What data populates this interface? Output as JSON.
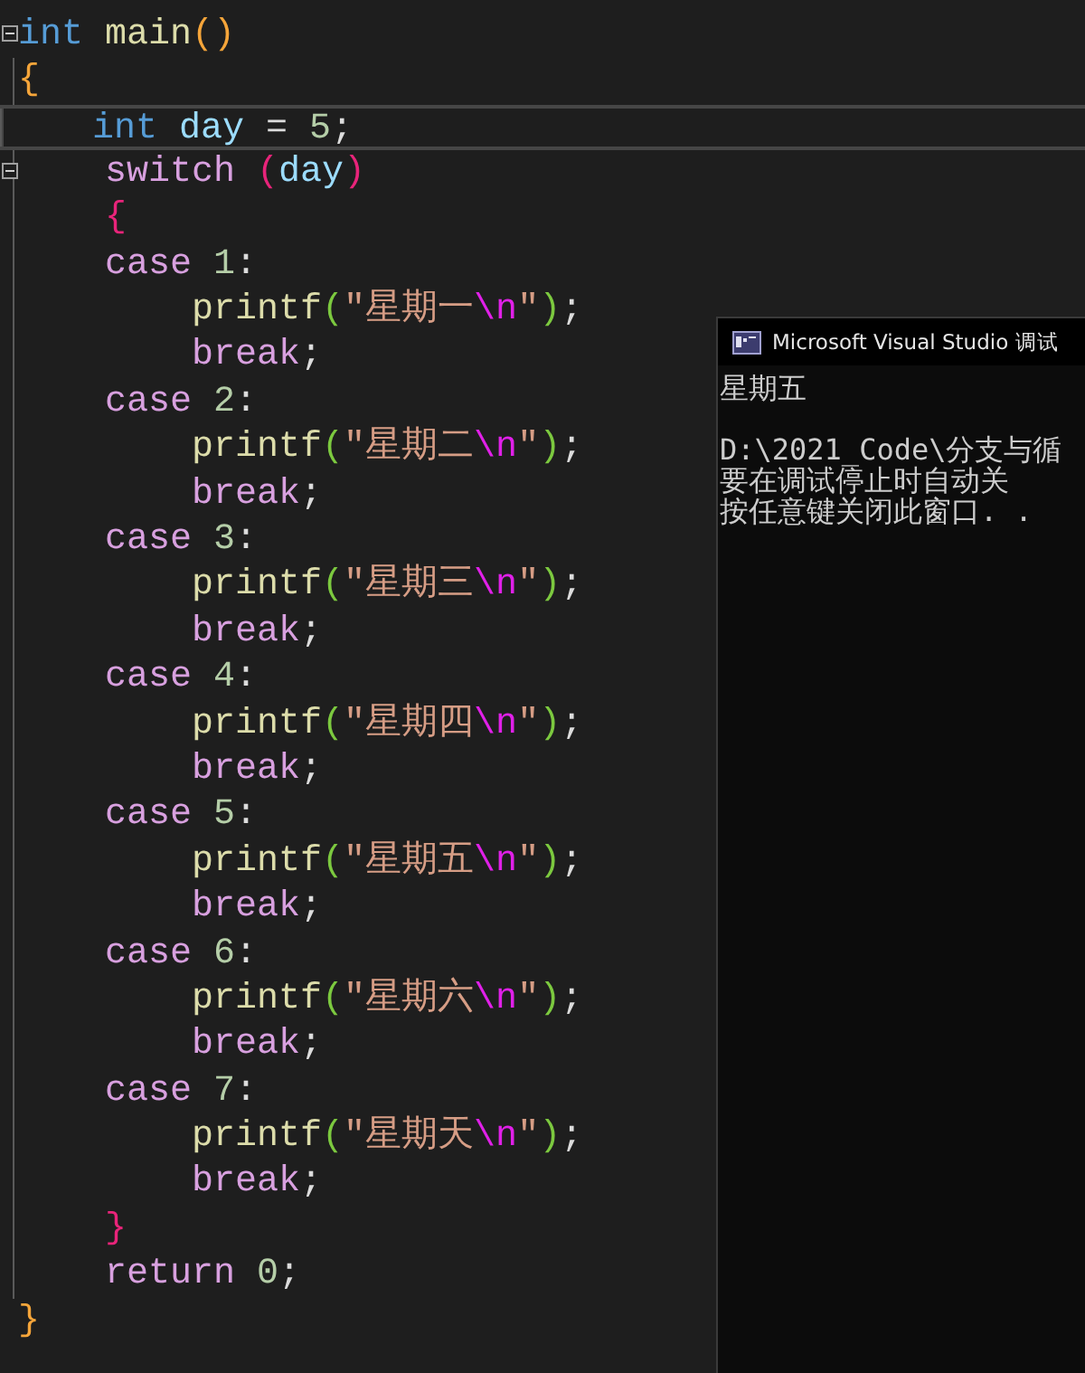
{
  "editor": {
    "lines": [
      {
        "foldable": true,
        "current": false,
        "tokens": [
          {
            "kind": "keyword",
            "space_before": false,
            "text": "int"
          },
          {
            "kind": "function",
            "space_before": true,
            "text": "main"
          },
          {
            "kind": "paren",
            "space_before": false,
            "text": "()"
          }
        ]
      },
      {
        "foldable": false,
        "current": false,
        "tokens": [
          {
            "kind": "brace",
            "space_before": false,
            "text": "{"
          }
        ],
        "children": [
          {
            "foldable": false,
            "current": true,
            "tokens": [
              {
                "kind": "keyword",
                "space_before": false,
                "text": "int"
              },
              {
                "kind": "variable",
                "space_before": true,
                "text": "day"
              },
              {
                "kind": "operator",
                "space_before": true,
                "text": "="
              },
              {
                "kind": "number",
                "space_before": true,
                "text": "5"
              },
              {
                "kind": "punct",
                "space_before": false,
                "text": ";"
              }
            ]
          },
          {
            "foldable": true,
            "current": false,
            "tokens": [
              {
                "kind": "control",
                "space_before": false,
                "text": "switch"
              },
              {
                "kind": "paren2",
                "space_before": true,
                "text": "("
              },
              {
                "kind": "variable",
                "space_before": false,
                "text": "day"
              },
              {
                "kind": "paren2",
                "space_before": false,
                "text": ")"
              }
            ]
          },
          {
            "foldable": false,
            "current": false,
            "tokens": [
              {
                "kind": "brace2",
                "space_before": false,
                "text": "{"
              }
            ]
          },
          {
            "foldable": false,
            "current": false,
            "tokens": [
              {
                "kind": "control",
                "space_before": false,
                "text": "case"
              },
              {
                "kind": "number",
                "space_before": true,
                "text": "1"
              },
              {
                "kind": "punct",
                "space_before": false,
                "text": ":"
              }
            ],
            "children": [
              {
                "foldable": false,
                "current": false,
                "tokens": [
                  {
                    "kind": "function",
                    "space_before": false,
                    "text": "printf"
                  },
                  {
                    "kind": "paren3",
                    "space_before": false,
                    "text": "("
                  },
                  {
                    "kind": "string",
                    "space_before": false,
                    "text": "\"星期一"
                  },
                  {
                    "kind": "escape",
                    "space_before": false,
                    "text": "\\n"
                  },
                  {
                    "kind": "string",
                    "space_before": false,
                    "text": "\""
                  },
                  {
                    "kind": "paren3",
                    "space_before": false,
                    "text": ")"
                  },
                  {
                    "kind": "punct",
                    "space_before": false,
                    "text": ";"
                  }
                ]
              },
              {
                "foldable": false,
                "current": false,
                "tokens": [
                  {
                    "kind": "control",
                    "space_before": false,
                    "text": "break"
                  },
                  {
                    "kind": "punct",
                    "space_before": false,
                    "text": ";"
                  }
                ]
              }
            ]
          },
          {
            "foldable": false,
            "current": false,
            "tokens": [
              {
                "kind": "control",
                "space_before": false,
                "text": "case"
              },
              {
                "kind": "number",
                "space_before": true,
                "text": "2"
              },
              {
                "kind": "punct",
                "space_before": false,
                "text": ":"
              }
            ],
            "children": [
              {
                "foldable": false,
                "current": false,
                "tokens": [
                  {
                    "kind": "function",
                    "space_before": false,
                    "text": "printf"
                  },
                  {
                    "kind": "paren3",
                    "space_before": false,
                    "text": "("
                  },
                  {
                    "kind": "string",
                    "space_before": false,
                    "text": "\"星期二"
                  },
                  {
                    "kind": "escape",
                    "space_before": false,
                    "text": "\\n"
                  },
                  {
                    "kind": "string",
                    "space_before": false,
                    "text": "\""
                  },
                  {
                    "kind": "paren3",
                    "space_before": false,
                    "text": ")"
                  },
                  {
                    "kind": "punct",
                    "space_before": false,
                    "text": ";"
                  }
                ]
              },
              {
                "foldable": false,
                "current": false,
                "tokens": [
                  {
                    "kind": "control",
                    "space_before": false,
                    "text": "break"
                  },
                  {
                    "kind": "punct",
                    "space_before": false,
                    "text": ";"
                  }
                ]
              }
            ]
          },
          {
            "foldable": false,
            "current": false,
            "tokens": [
              {
                "kind": "control",
                "space_before": false,
                "text": "case"
              },
              {
                "kind": "number",
                "space_before": true,
                "text": "3"
              },
              {
                "kind": "punct",
                "space_before": false,
                "text": ":"
              }
            ],
            "children": [
              {
                "foldable": false,
                "current": false,
                "tokens": [
                  {
                    "kind": "function",
                    "space_before": false,
                    "text": "printf"
                  },
                  {
                    "kind": "paren3",
                    "space_before": false,
                    "text": "("
                  },
                  {
                    "kind": "string",
                    "space_before": false,
                    "text": "\"星期三"
                  },
                  {
                    "kind": "escape",
                    "space_before": false,
                    "text": "\\n"
                  },
                  {
                    "kind": "string",
                    "space_before": false,
                    "text": "\""
                  },
                  {
                    "kind": "paren3",
                    "space_before": false,
                    "text": ")"
                  },
                  {
                    "kind": "punct",
                    "space_before": false,
                    "text": ";"
                  }
                ]
              },
              {
                "foldable": false,
                "current": false,
                "tokens": [
                  {
                    "kind": "control",
                    "space_before": false,
                    "text": "break"
                  },
                  {
                    "kind": "punct",
                    "space_before": false,
                    "text": ";"
                  }
                ]
              }
            ]
          },
          {
            "foldable": false,
            "current": false,
            "tokens": [
              {
                "kind": "control",
                "space_before": false,
                "text": "case"
              },
              {
                "kind": "number",
                "space_before": true,
                "text": "4"
              },
              {
                "kind": "punct",
                "space_before": false,
                "text": ":"
              }
            ],
            "children": [
              {
                "foldable": false,
                "current": false,
                "tokens": [
                  {
                    "kind": "function",
                    "space_before": false,
                    "text": "printf"
                  },
                  {
                    "kind": "paren3",
                    "space_before": false,
                    "text": "("
                  },
                  {
                    "kind": "string",
                    "space_before": false,
                    "text": "\"星期四"
                  },
                  {
                    "kind": "escape",
                    "space_before": false,
                    "text": "\\n"
                  },
                  {
                    "kind": "string",
                    "space_before": false,
                    "text": "\""
                  },
                  {
                    "kind": "paren3",
                    "space_before": false,
                    "text": ")"
                  },
                  {
                    "kind": "punct",
                    "space_before": false,
                    "text": ";"
                  }
                ]
              },
              {
                "foldable": false,
                "current": false,
                "tokens": [
                  {
                    "kind": "control",
                    "space_before": false,
                    "text": "break"
                  },
                  {
                    "kind": "punct",
                    "space_before": false,
                    "text": ";"
                  }
                ]
              }
            ]
          },
          {
            "foldable": false,
            "current": false,
            "tokens": [
              {
                "kind": "control",
                "space_before": false,
                "text": "case"
              },
              {
                "kind": "number",
                "space_before": true,
                "text": "5"
              },
              {
                "kind": "punct",
                "space_before": false,
                "text": ":"
              }
            ],
            "children": [
              {
                "foldable": false,
                "current": false,
                "tokens": [
                  {
                    "kind": "function",
                    "space_before": false,
                    "text": "printf"
                  },
                  {
                    "kind": "paren3",
                    "space_before": false,
                    "text": "("
                  },
                  {
                    "kind": "string",
                    "space_before": false,
                    "text": "\"星期五"
                  },
                  {
                    "kind": "escape",
                    "space_before": false,
                    "text": "\\n"
                  },
                  {
                    "kind": "string",
                    "space_before": false,
                    "text": "\""
                  },
                  {
                    "kind": "paren3",
                    "space_before": false,
                    "text": ")"
                  },
                  {
                    "kind": "punct",
                    "space_before": false,
                    "text": ";"
                  }
                ]
              },
              {
                "foldable": false,
                "current": false,
                "tokens": [
                  {
                    "kind": "control",
                    "space_before": false,
                    "text": "break"
                  },
                  {
                    "kind": "punct",
                    "space_before": false,
                    "text": ";"
                  }
                ]
              }
            ]
          },
          {
            "foldable": false,
            "current": false,
            "tokens": [
              {
                "kind": "control",
                "space_before": false,
                "text": "case"
              },
              {
                "kind": "number",
                "space_before": true,
                "text": "6"
              },
              {
                "kind": "punct",
                "space_before": false,
                "text": ":"
              }
            ],
            "children": [
              {
                "foldable": false,
                "current": false,
                "tokens": [
                  {
                    "kind": "function",
                    "space_before": false,
                    "text": "printf"
                  },
                  {
                    "kind": "paren3",
                    "space_before": false,
                    "text": "("
                  },
                  {
                    "kind": "string",
                    "space_before": false,
                    "text": "\"星期六"
                  },
                  {
                    "kind": "escape",
                    "space_before": false,
                    "text": "\\n"
                  },
                  {
                    "kind": "string",
                    "space_before": false,
                    "text": "\""
                  },
                  {
                    "kind": "paren3",
                    "space_before": false,
                    "text": ")"
                  },
                  {
                    "kind": "punct",
                    "space_before": false,
                    "text": ";"
                  }
                ]
              },
              {
                "foldable": false,
                "current": false,
                "tokens": [
                  {
                    "kind": "control",
                    "space_before": false,
                    "text": "break"
                  },
                  {
                    "kind": "punct",
                    "space_before": false,
                    "text": ";"
                  }
                ]
              }
            ]
          },
          {
            "foldable": false,
            "current": false,
            "tokens": [
              {
                "kind": "control",
                "space_before": false,
                "text": "case"
              },
              {
                "kind": "number",
                "space_before": true,
                "text": "7"
              },
              {
                "kind": "punct",
                "space_before": false,
                "text": ":"
              }
            ],
            "children": [
              {
                "foldable": false,
                "current": false,
                "tokens": [
                  {
                    "kind": "function",
                    "space_before": false,
                    "text": "printf"
                  },
                  {
                    "kind": "paren3",
                    "space_before": false,
                    "text": "("
                  },
                  {
                    "kind": "string",
                    "space_before": false,
                    "text": "\"星期天"
                  },
                  {
                    "kind": "escape",
                    "space_before": false,
                    "text": "\\n"
                  },
                  {
                    "kind": "string",
                    "space_before": false,
                    "text": "\""
                  },
                  {
                    "kind": "paren3",
                    "space_before": false,
                    "text": ")"
                  },
                  {
                    "kind": "punct",
                    "space_before": false,
                    "text": ";"
                  }
                ]
              },
              {
                "foldable": false,
                "current": false,
                "tokens": [
                  {
                    "kind": "control",
                    "space_before": false,
                    "text": "break"
                  },
                  {
                    "kind": "punct",
                    "space_before": false,
                    "text": ";"
                  }
                ]
              }
            ]
          },
          {
            "foldable": false,
            "current": false,
            "tokens": [
              {
                "kind": "brace2",
                "space_before": false,
                "text": "}"
              }
            ]
          },
          {
            "foldable": false,
            "current": false,
            "tokens": [
              {
                "kind": "control",
                "space_before": false,
                "text": "return"
              },
              {
                "kind": "number",
                "space_before": true,
                "text": "0"
              },
              {
                "kind": "punct",
                "space_before": false,
                "text": ";"
              }
            ]
          }
        ]
      },
      {
        "foldable": false,
        "current": false,
        "tokens": [
          {
            "kind": "brace",
            "space_before": false,
            "text": "}"
          }
        ]
      }
    ]
  },
  "console": {
    "title": "Microsoft Visual Studio 调试",
    "output": [
      "星期五"
    ],
    "messages": [
      "D:\\2021_Code\\分支与循",
      "要在调试停止时自动关",
      "按任意键关闭此窗口. ."
    ]
  }
}
